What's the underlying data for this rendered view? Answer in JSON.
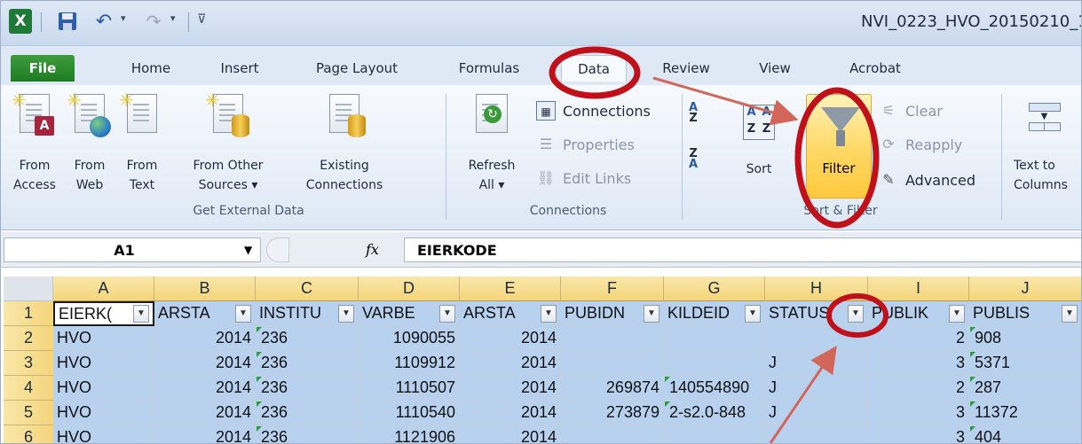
{
  "window": {
    "title": "NVI_0223_HVO_20150210_1",
    "excel_icon": "X"
  },
  "tabs": [
    {
      "label": "File"
    },
    {
      "label": "Home"
    },
    {
      "label": "Insert"
    },
    {
      "label": "Page Layout"
    },
    {
      "label": "Formulas"
    },
    {
      "label": "Data"
    },
    {
      "label": "Review"
    },
    {
      "label": "View"
    },
    {
      "label": "Acrobat"
    }
  ],
  "ribbon": {
    "get_external_data": {
      "label": "Get External Data",
      "buttons": [
        {
          "label": "From\nAccess",
          "icon": "access-icon"
        },
        {
          "label": "From\nWeb",
          "icon": "web-icon"
        },
        {
          "label": "From\nText",
          "icon": "text-file-icon"
        },
        {
          "label": "From Other\nSources ▾",
          "icon": "other-sources-icon"
        },
        {
          "label": "Existing\nConnections",
          "icon": "existing-connections-icon"
        }
      ]
    },
    "connections": {
      "label": "Connections",
      "refresh": "Refresh\nAll ▾",
      "items": [
        "Connections",
        "Properties",
        "Edit Links"
      ]
    },
    "sort_filter": {
      "label": "Sort & Filter",
      "sort": "Sort",
      "filter": "Filter",
      "clear": "Clear",
      "reapply": "Reapply",
      "advanced": "Advanced"
    },
    "data_tools": {
      "text_to_columns": "Text to\nColumns"
    }
  },
  "formula_bar": {
    "name_box": "A1",
    "fx": "fx",
    "value": "EIERKODE"
  },
  "grid": {
    "columns": [
      "A",
      "B",
      "C",
      "D",
      "E",
      "F",
      "G",
      "H",
      "I",
      "J"
    ],
    "rows": [
      "1",
      "2",
      "3",
      "4",
      "5",
      "6"
    ],
    "header_cells": [
      "EIERK(",
      "ARSTA",
      "INSTITU",
      "VARBE",
      "ARSTA",
      "PUBIDN",
      "KILDEID",
      "STATUS",
      "PUBLIK",
      "PUBLIS"
    ],
    "data": [
      [
        "HVO",
        "2014",
        "236",
        "1090055",
        "2014",
        "",
        "",
        "",
        "2",
        "908"
      ],
      [
        "HVO",
        "2014",
        "236",
        "1109912",
        "2014",
        "",
        "",
        "J",
        "3",
        "5371"
      ],
      [
        "HVO",
        "2014",
        "236",
        "1110507",
        "2014",
        "269874",
        "140554890",
        "J",
        "2",
        "287"
      ],
      [
        "HVO",
        "2014",
        "236",
        "1110540",
        "2014",
        "273879",
        "2-s2.0-848",
        "J",
        "3",
        "11372"
      ],
      [
        "HVO",
        "2014",
        "236",
        "1121906",
        "2014",
        "",
        "",
        "",
        "3",
        "404"
      ]
    ]
  },
  "colors": {
    "highlight_ring": "#c0111a",
    "arrow": "#d2665a",
    "selection": "#b8d1ef",
    "file_tab": "#1e7b22"
  }
}
